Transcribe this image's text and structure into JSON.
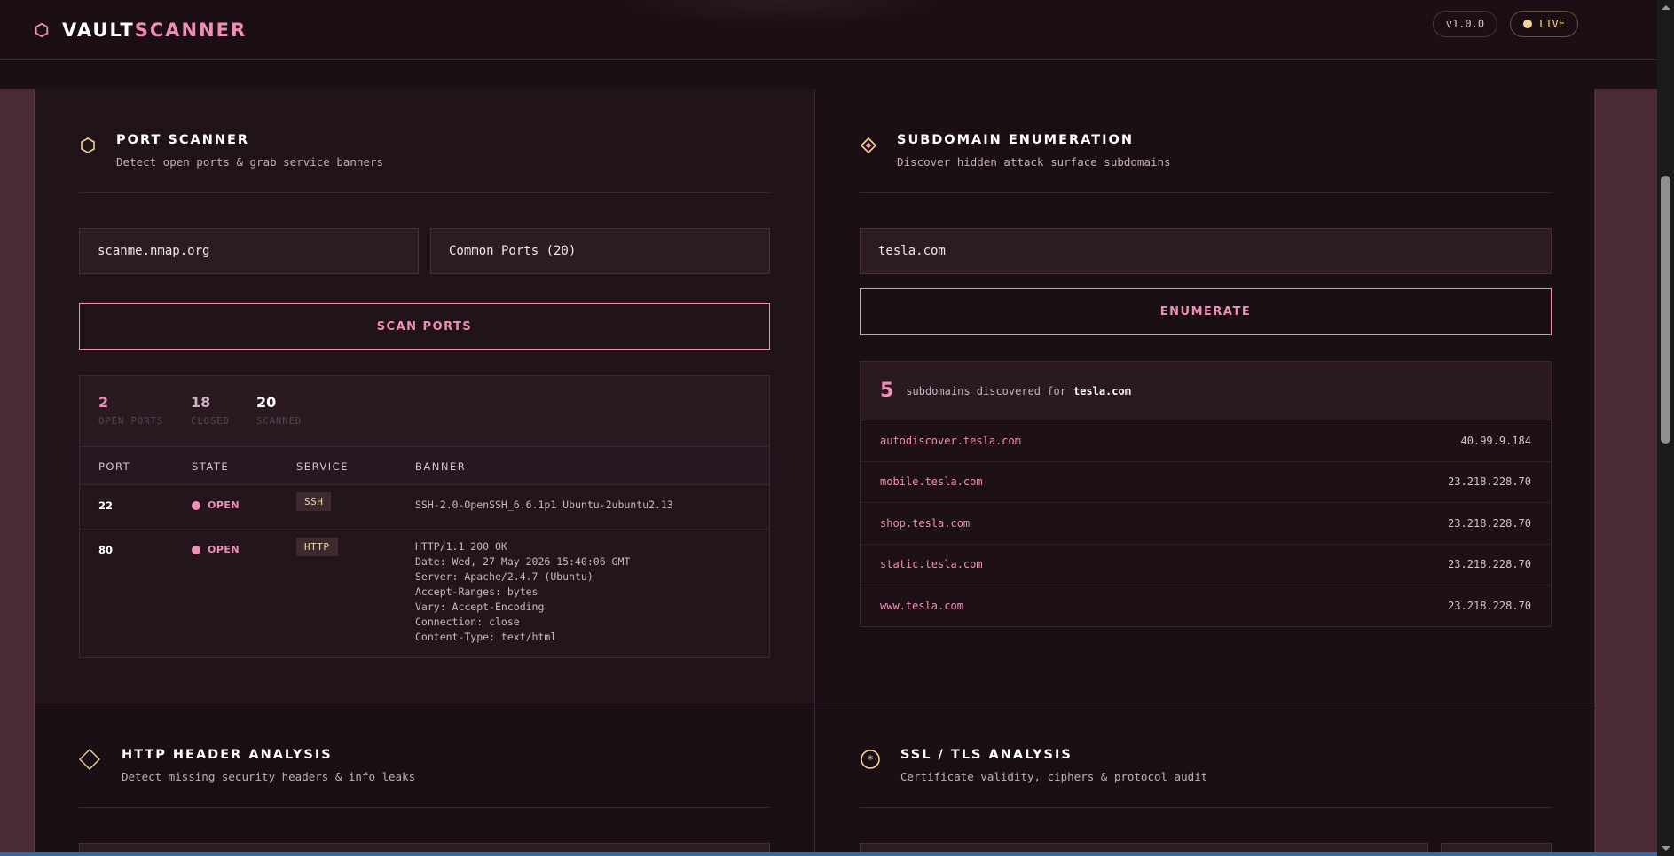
{
  "header": {
    "logo_part1": "VAULT",
    "logo_part2": "SCANNER",
    "version": "v1.0.0",
    "live_label": "LIVE"
  },
  "port_scanner": {
    "title": "PORT SCANNER",
    "subtitle": "Detect open ports & grab service banners",
    "target_value": "scanme.nmap.org",
    "ports_select": "Common Ports (20)",
    "scan_button": "SCAN PORTS",
    "stats": [
      {
        "value": "2",
        "label": "OPEN PORTS",
        "color": "#f08fb4"
      },
      {
        "value": "18",
        "label": "CLOSED",
        "color": "#c9b5bf"
      },
      {
        "value": "20",
        "label": "SCANNED",
        "color": "#ffffff"
      }
    ],
    "columns": [
      "PORT",
      "STATE",
      "SERVICE",
      "BANNER"
    ],
    "rows": [
      {
        "port": "22",
        "state": "OPEN",
        "service": "SSH",
        "banner": "SSH-2.0-OpenSSH_6.6.1p1 Ubuntu-2ubuntu2.13"
      },
      {
        "port": "80",
        "state": "OPEN",
        "service": "HTTP",
        "banner": "HTTP/1.1 200 OK\nDate: Wed, 27 May 2026 15:40:06 GMT\nServer: Apache/2.4.7 (Ubuntu)\nAccept-Ranges: bytes\nVary: Accept-Encoding\nConnection: close\nContent-Type: text/html"
      }
    ]
  },
  "subdomain": {
    "title": "SUBDOMAIN ENUMERATION",
    "subtitle": "Discover hidden attack surface subdomains",
    "domain_value": "tesla.com",
    "button": "ENUMERATE",
    "count": "5",
    "summary_text": "subdomains discovered for",
    "summary_domain": "tesla.com",
    "items": [
      {
        "name": "autodiscover.tesla.com",
        "ip": "40.99.9.184"
      },
      {
        "name": "mobile.tesla.com",
        "ip": "23.218.228.70"
      },
      {
        "name": "shop.tesla.com",
        "ip": "23.218.228.70"
      },
      {
        "name": "static.tesla.com",
        "ip": "23.218.228.70"
      },
      {
        "name": "www.tesla.com",
        "ip": "23.218.228.70"
      }
    ]
  },
  "http_headers": {
    "title": "HTTP HEADER ANALYSIS",
    "subtitle": "Detect missing security headers & info leaks"
  },
  "ssl_tls": {
    "title": "SSL / TLS ANALYSIS",
    "subtitle": "Certificate validity, ciphers & protocol audit"
  },
  "colors": {
    "accent_pink": "#f08fb4",
    "accent_gold": "#f3d39a",
    "bg": "#140b10"
  }
}
